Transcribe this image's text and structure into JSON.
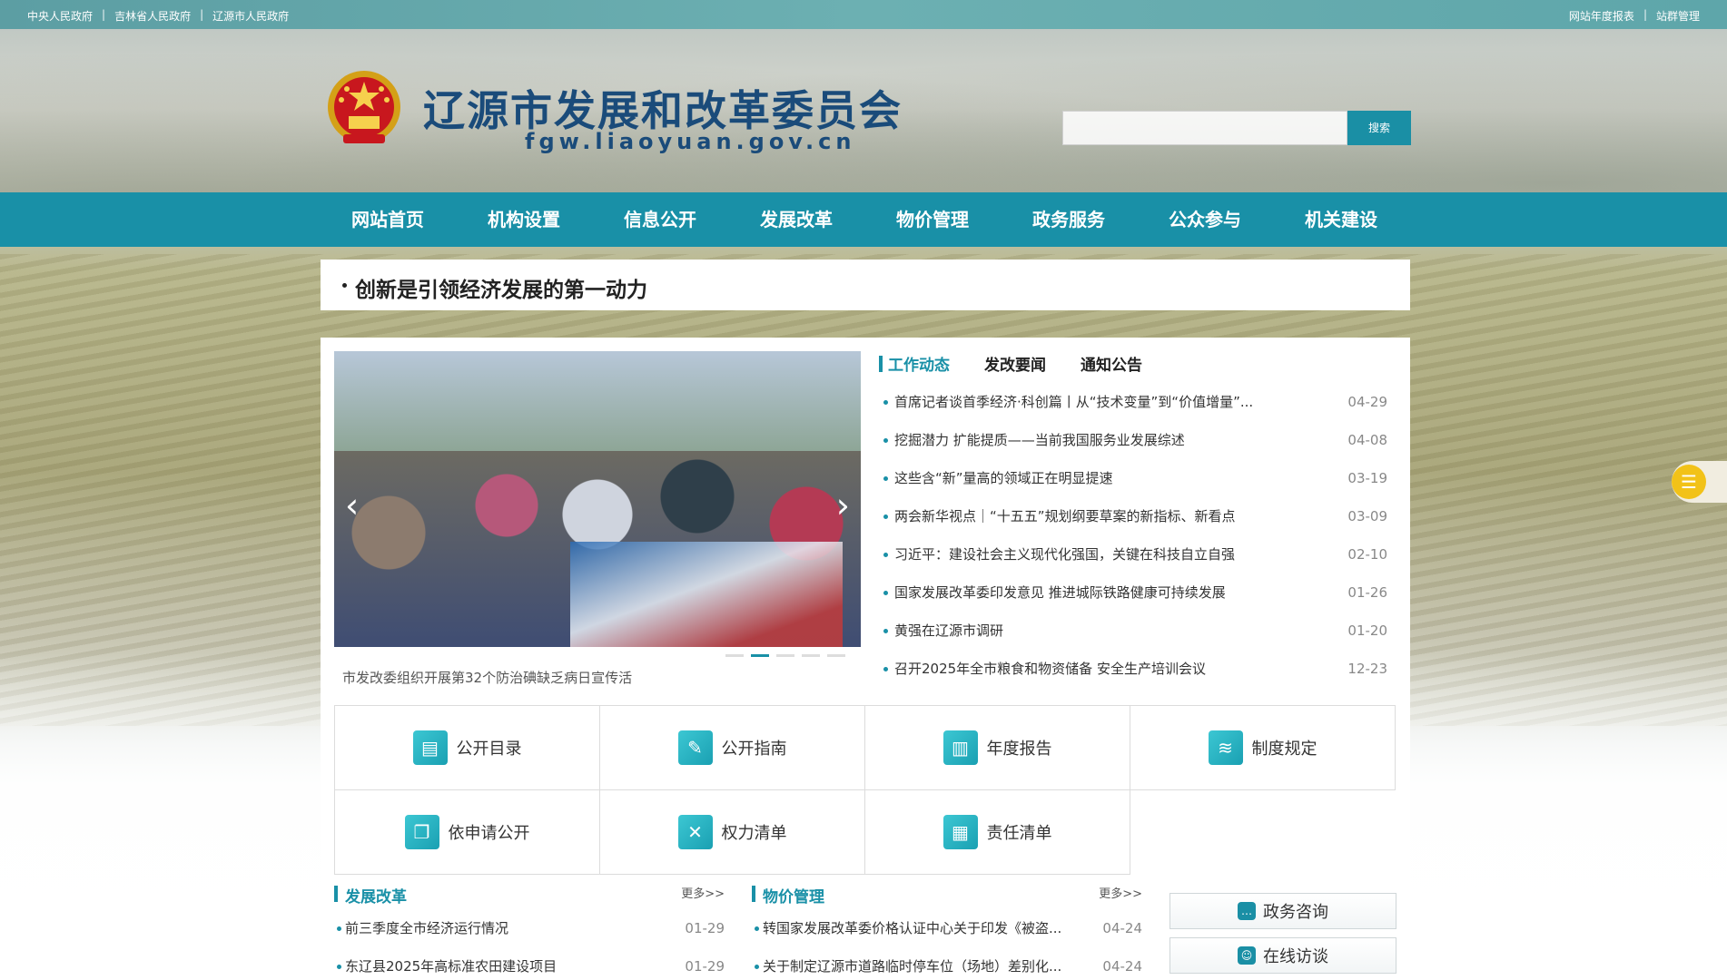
{
  "colors": {
    "accent": "#1990a7",
    "title": "#1a4b7a",
    "topbar": "#6cb0b2"
  },
  "topbar": {
    "left_links": [
      "中央人民政府",
      "吉林省人民政府",
      "辽源市人民政府"
    ],
    "separator": "|",
    "right_links": [
      "网站年度报表",
      "站群管理"
    ]
  },
  "header": {
    "title": "辽源市发展和改革委员会",
    "domain": "fgw.liaoyuan.gov.cn",
    "emblem": "national-emblem-icon",
    "search": {
      "placeholder": "",
      "button": "搜索"
    }
  },
  "nav": {
    "items": [
      "网站首页",
      "机构设置",
      "信息公开",
      "发展改革",
      "物价管理",
      "政务服务",
      "公众参与",
      "机关建设"
    ]
  },
  "headline": {
    "text": "创新是引领经济发展的第一动力"
  },
  "slider": {
    "caption": "市发改委组织开展第32个防治碘缺乏病日宣传活",
    "prev": "‹",
    "next": "›",
    "dot_count": 5,
    "active_dot": 2
  },
  "news": {
    "tabs": [
      "工作动态",
      "发改要闻",
      "通知公告"
    ],
    "active_tab": 0,
    "items": [
      {
        "title": "首席记者谈首季经济·科创篇丨从“技术变量”到“价值增量”...",
        "date": "04-29"
      },
      {
        "title": "挖掘潜力 扩能提质——当前我国服务业发展综述",
        "date": "04-08"
      },
      {
        "title": "这些含“新”量高的领域正在明显提速",
        "date": "03-19"
      },
      {
        "title": "两会新华视点｜“十五五”规划纲要草案的新指标、新看点",
        "date": "03-09"
      },
      {
        "title": "习近平：建设社会主义现代化强国，关键在科技自立自强",
        "date": "02-10"
      },
      {
        "title": "国家发展改革委印发意见 推进城际铁路健康可持续发展",
        "date": "01-26"
      },
      {
        "title": "黄强在辽源市调研",
        "date": "01-20"
      },
      {
        "title": "召开2025年全市粮食和物资储备 安全生产培训会议",
        "date": "12-23"
      }
    ]
  },
  "quick_links": [
    {
      "label": "公开目录",
      "icon": "catalog-icon",
      "glyph": "▤"
    },
    {
      "label": "公开指南",
      "icon": "guide-icon",
      "glyph": "✎"
    },
    {
      "label": "年度报告",
      "icon": "report-icon",
      "glyph": "▥"
    },
    {
      "label": "制度规定",
      "icon": "layers-icon",
      "glyph": "≋"
    },
    {
      "label": "依申请公开",
      "icon": "apply-icon",
      "glyph": "❐"
    },
    {
      "label": "权力清单",
      "icon": "power-icon",
      "glyph": "✕"
    },
    {
      "label": "责任清单",
      "icon": "duty-icon",
      "glyph": "▦"
    }
  ],
  "sections": {
    "reform": {
      "title": "发展改革",
      "more": "更多>>",
      "items": [
        {
          "title": "前三季度全市经济运行情况",
          "date": "01-29"
        },
        {
          "title": "东辽县2025年高标准农田建设项目",
          "date": "01-29"
        }
      ]
    },
    "price": {
      "title": "物价管理",
      "more": "更多>>",
      "items": [
        {
          "title": "转国家发展改革委价格认证中心关于印发《被盗...",
          "date": "04-24"
        },
        {
          "title": "关于制定辽源市道路临时停车位（场地）差别化...",
          "date": "04-24"
        }
      ]
    }
  },
  "side_buttons": [
    {
      "label": "政务咨询",
      "icon": "chat-icon",
      "glyph": "…"
    },
    {
      "label": "在线访谈",
      "icon": "interview-icon",
      "glyph": "☺"
    }
  ],
  "float_widget": {
    "icon": "list-menu-icon",
    "glyph": "☰"
  }
}
